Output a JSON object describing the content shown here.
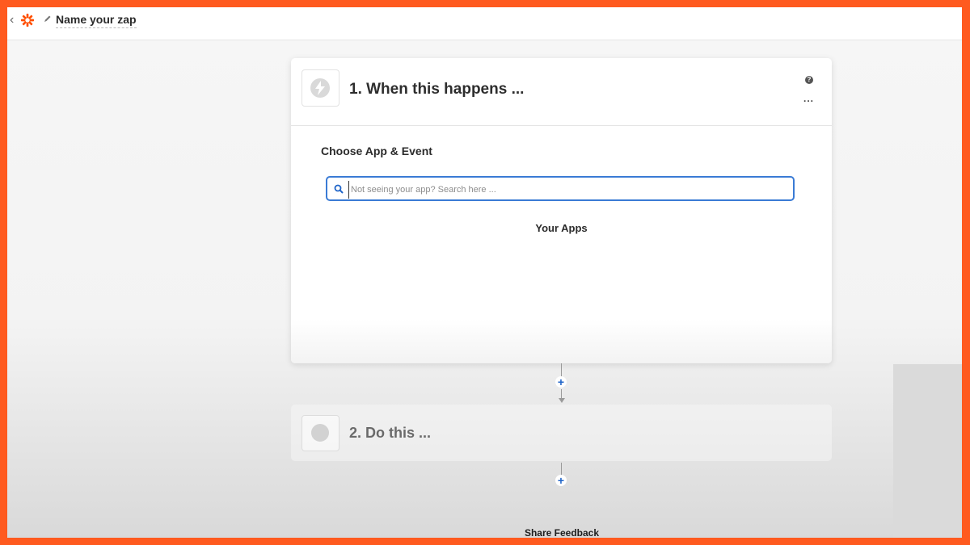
{
  "topbar": {
    "back_icon": "chevron-left-icon",
    "logo_icon": "zapier-asterisk-icon",
    "edit_icon": "pencil-icon",
    "zap_name": "Name your zap"
  },
  "step1": {
    "title": "1. When this happens ...",
    "trigger_icon": "lightning-bolt-icon",
    "help_icon": "question-icon",
    "more_icon": "ellipsis-icon",
    "more_label": "...",
    "help_label": "?",
    "section_title": "Choose App & Event",
    "search": {
      "placeholder": "Not seeing your app? Search here ...",
      "value": ""
    },
    "your_apps_label": "Your Apps"
  },
  "connectors": {
    "plus_label": "+"
  },
  "step2": {
    "title": "2. Do this ..."
  },
  "footer": {
    "share_feedback": "Share Feedback"
  },
  "colors": {
    "frame_border": "#ff5a1f",
    "accent_blue": "#1f64c8",
    "search_border": "#3a7bd5",
    "brand_orange": "#ff4f00"
  }
}
